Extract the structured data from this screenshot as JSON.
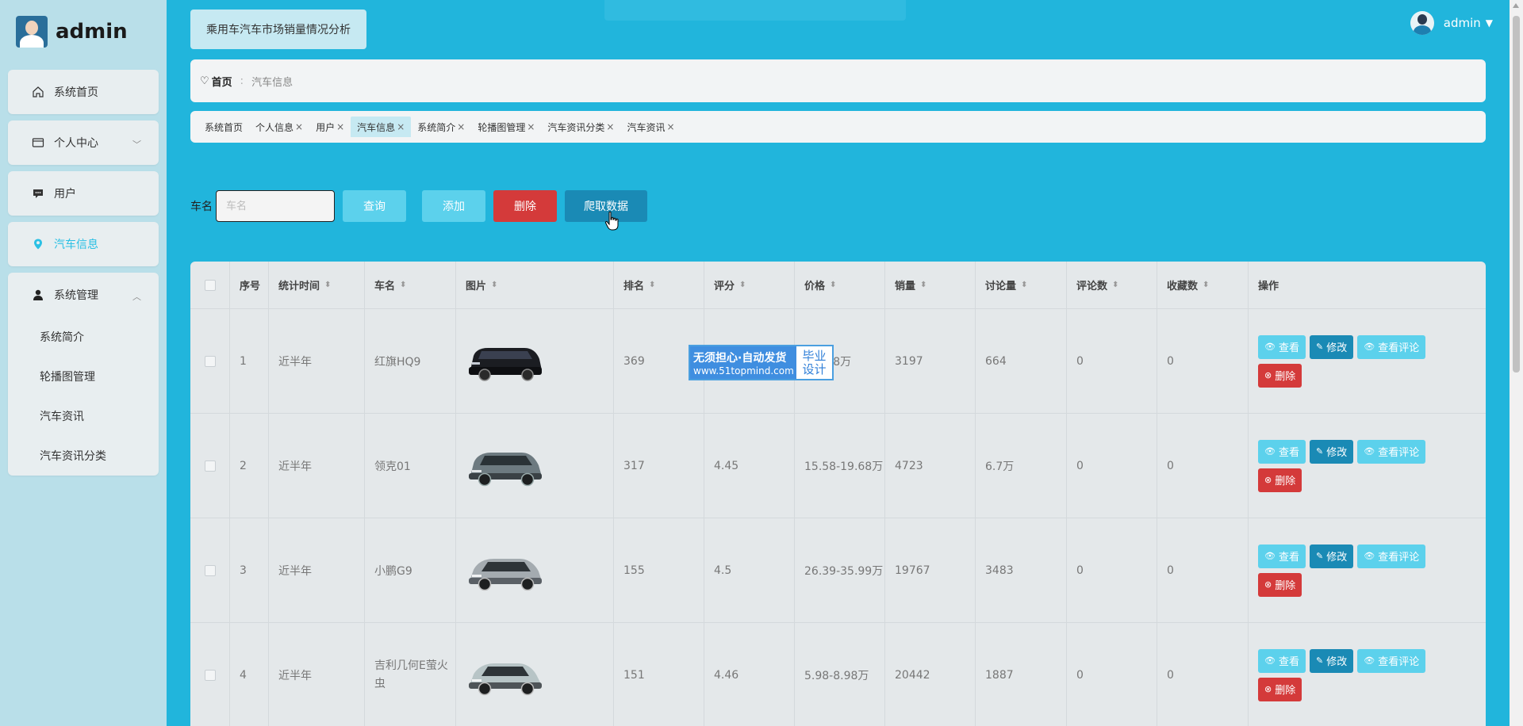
{
  "sidebar": {
    "logo_text": "admin",
    "menu": [
      {
        "label": "系统首页"
      },
      {
        "label": "个人中心"
      },
      {
        "label": "用户"
      },
      {
        "label": "汽车信息"
      },
      {
        "label": "系统管理"
      }
    ],
    "submenu": [
      {
        "label": "系统简介"
      },
      {
        "label": "轮播图管理"
      },
      {
        "label": "汽车资讯"
      },
      {
        "label": "汽车资讯分类"
      }
    ]
  },
  "header": {
    "page_title": "乘用车汽车市场销量情况分析",
    "username": "admin"
  },
  "breadcrumb": {
    "home": "首页",
    "current": "汽车信息"
  },
  "tabs": [
    {
      "label": "系统首页"
    },
    {
      "label": "个人信息"
    },
    {
      "label": "用户"
    },
    {
      "label": "汽车信息"
    },
    {
      "label": "系统简介"
    },
    {
      "label": "轮播图管理"
    },
    {
      "label": "汽车资讯分类"
    },
    {
      "label": "汽车资讯"
    }
  ],
  "search": {
    "label": "车名",
    "placeholder": "车名",
    "query_label": "查询",
    "add_label": "添加",
    "delete_label": "删除",
    "crawl_label": "爬取数据"
  },
  "table": {
    "headers": {
      "index": "序号",
      "stat_time": "统计时间",
      "car_name": "车名",
      "image": "图片",
      "rank": "排名",
      "score": "评分",
      "price": "价格",
      "sales": "销量",
      "discussions": "讨论量",
      "comments": "评论数",
      "favorites": "收藏数",
      "actions": "操作"
    },
    "rows": [
      {
        "index": "1",
        "stat_time": "近半年",
        "car_name": "红旗HQ9",
        "rank": "369",
        "score": "",
        "price": "-53.88万",
        "sales": "3197",
        "discussions": "664",
        "comments": "0",
        "favorites": "0"
      },
      {
        "index": "2",
        "stat_time": "近半年",
        "car_name": "领克01",
        "rank": "317",
        "score": "4.45",
        "price": "15.58-19.68万",
        "sales": "4723",
        "discussions": "6.7万",
        "comments": "0",
        "favorites": "0"
      },
      {
        "index": "3",
        "stat_time": "近半年",
        "car_name": "小鹏G9",
        "rank": "155",
        "score": "4.5",
        "price": "26.39-35.99万",
        "sales": "19767",
        "discussions": "3483",
        "comments": "0",
        "favorites": "0"
      },
      {
        "index": "4",
        "stat_time": "近半年",
        "car_name": "吉利几何E萤火虫",
        "rank": "151",
        "score": "4.46",
        "price": "5.98-8.98万",
        "sales": "20442",
        "discussions": "1887",
        "comments": "0",
        "favorites": "0"
      }
    ],
    "actions": {
      "view": "查看",
      "edit": "修改",
      "view_reviews": "查看评论",
      "delete": "删除"
    }
  },
  "watermark": {
    "line1": "无须担心·自动发货",
    "line2": "www.51topmind.com",
    "right1": "毕业",
    "right2": "设计"
  },
  "colors": {
    "accent": "#21b5dc",
    "primary_btn": "#5cd1ec",
    "dark_btn": "#1a8ab5",
    "danger": "#d43a3a"
  }
}
